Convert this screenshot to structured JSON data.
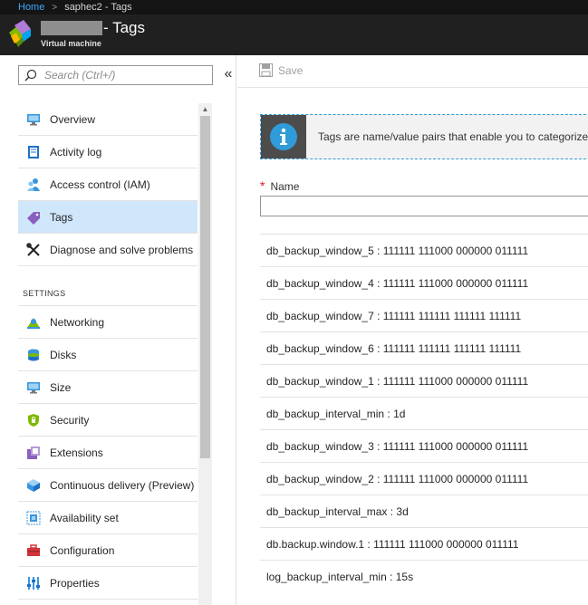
{
  "breadcrumb": {
    "home": "Home",
    "separator": ">",
    "current": "saphec2 - Tags"
  },
  "header": {
    "title": "- Tags",
    "subtitle": "Virtual machine"
  },
  "search": {
    "placeholder": "Search (Ctrl+/)"
  },
  "collapse_label": "«",
  "sidebar": {
    "items": [
      {
        "label": "Overview",
        "icon": "monitor-icon",
        "active": false
      },
      {
        "label": "Activity log",
        "icon": "activity-log-icon",
        "active": false
      },
      {
        "label": "Access control (IAM)",
        "icon": "people-icon",
        "active": false
      },
      {
        "label": "Tags",
        "icon": "tag-icon",
        "active": true
      },
      {
        "label": "Diagnose and solve problems",
        "icon": "wrench-icon",
        "active": false
      }
    ],
    "section_settings": "SETTINGS",
    "settings_items": [
      {
        "label": "Networking",
        "icon": "network-icon"
      },
      {
        "label": "Disks",
        "icon": "disks-icon"
      },
      {
        "label": "Size",
        "icon": "size-icon"
      },
      {
        "label": "Security",
        "icon": "shield-icon"
      },
      {
        "label": "Extensions",
        "icon": "extensions-icon"
      },
      {
        "label": "Continuous delivery (Preview)",
        "icon": "cube-icon"
      },
      {
        "label": "Availability set",
        "icon": "availability-icon"
      },
      {
        "label": "Configuration",
        "icon": "toolbox-icon"
      },
      {
        "label": "Properties",
        "icon": "properties-icon"
      }
    ]
  },
  "toolbar": {
    "save_label": "Save"
  },
  "info": {
    "text": "Tags are name/value pairs that enable you to categorize"
  },
  "form": {
    "name_label": "Name",
    "required_mark": "*",
    "name_value": ""
  },
  "tags": [
    "db_backup_window_5 : 111111 111000 000000 011111",
    "db_backup_window_4 : 111111 111000 000000 011111",
    "db_backup_window_7 : 111111 111111 111111 111111",
    "db_backup_window_6 : 111111 111111 111111 111111",
    "db_backup_window_1 : 111111 111000 000000 011111",
    "db_backup_interval_min : 1d",
    "db_backup_window_3 : 111111 111000 000000 011111",
    "db_backup_window_2 : 111111 111000 000000 011111",
    "db_backup_interval_max : 3d",
    "db.backup.window.1 : 111111 111000 000000 011111",
    "log_backup_interval_min : 15s"
  ],
  "colors": {
    "accent": "#3fa9ff",
    "active_nav": "#cfe6fb",
    "header_bg": "#202020"
  }
}
